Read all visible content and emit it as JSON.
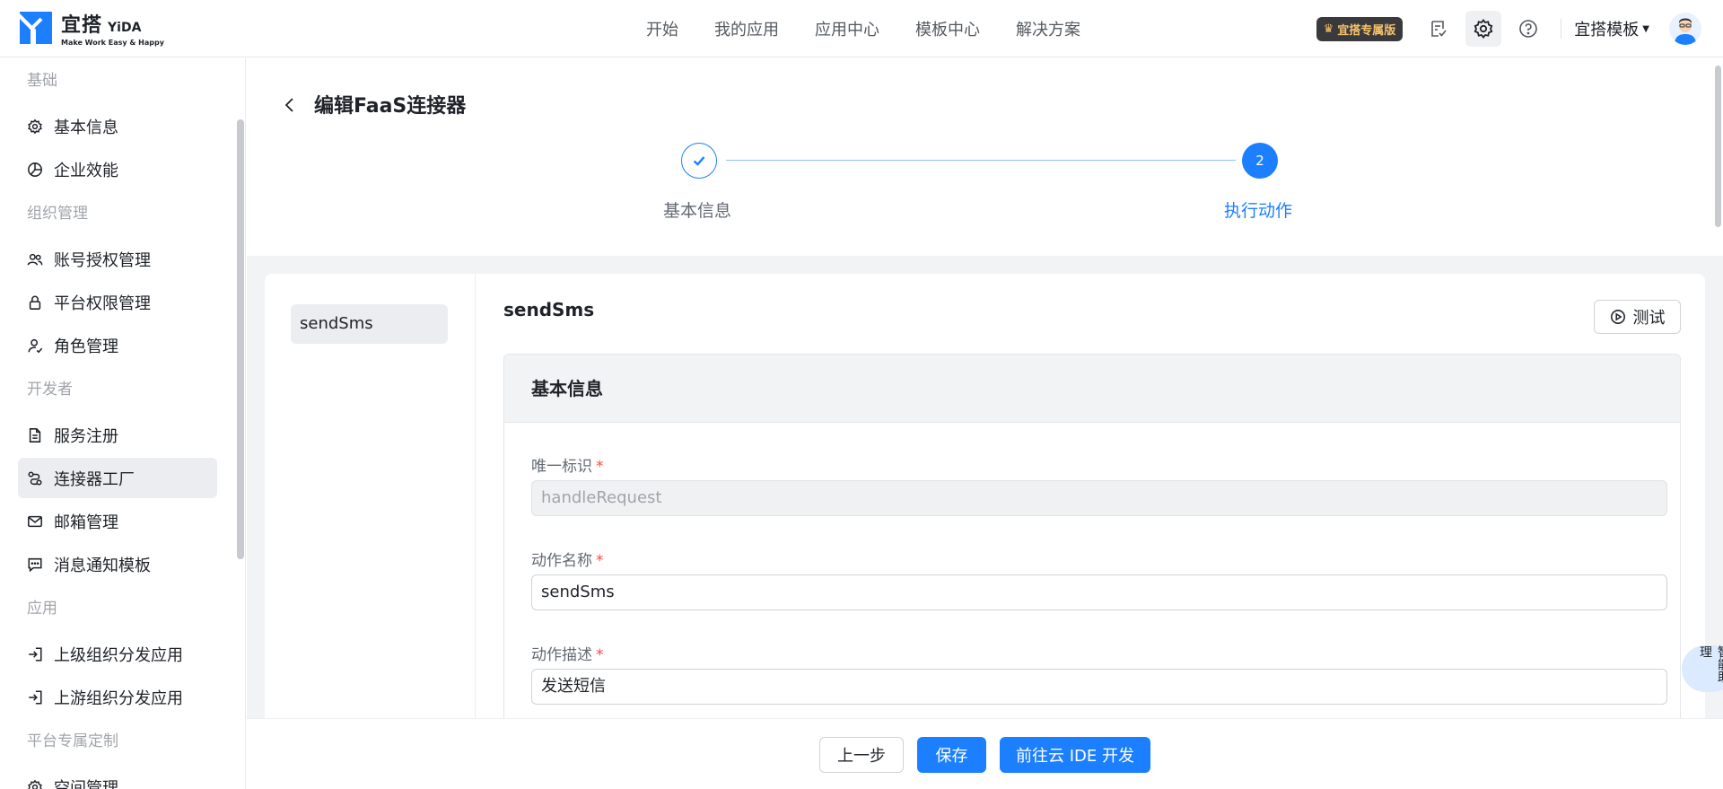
{
  "logo": {
    "cn": "宜搭",
    "en": "YiDA",
    "sub": "Make Work Easy & Happy"
  },
  "nav": [
    "开始",
    "我的应用",
    "应用中心",
    "模板中心",
    "解决方案"
  ],
  "topRight": {
    "vip": "宜搭专属版",
    "templateMenu": "宜搭模板"
  },
  "sidebar": {
    "groups": [
      {
        "title": "基础",
        "items": [
          {
            "label": "基本信息",
            "icon": "gear-icon"
          },
          {
            "label": "企业效能",
            "icon": "pie-chart-icon"
          }
        ]
      },
      {
        "title": "组织管理",
        "items": [
          {
            "label": "账号授权管理",
            "icon": "users-icon"
          },
          {
            "label": "平台权限管理",
            "icon": "lock-icon"
          },
          {
            "label": "角色管理",
            "icon": "user-role-icon"
          }
        ]
      },
      {
        "title": "开发者",
        "items": [
          {
            "label": "服务注册",
            "icon": "document-icon"
          },
          {
            "label": "连接器工厂",
            "icon": "connector-icon",
            "active": true
          },
          {
            "label": "邮箱管理",
            "icon": "mail-icon"
          },
          {
            "label": "消息通知模板",
            "icon": "message-icon"
          }
        ]
      },
      {
        "title": "应用",
        "items": [
          {
            "label": "上级组织分发应用",
            "icon": "import-icon"
          },
          {
            "label": "上游组织分发应用",
            "icon": "import-icon"
          }
        ]
      },
      {
        "title": "平台专属定制",
        "items": [
          {
            "label": "空间管理",
            "icon": "gear-icon"
          }
        ]
      }
    ]
  },
  "page": {
    "title": "编辑FaaS连接器",
    "steps": [
      {
        "label": "基本信息",
        "status": "done"
      },
      {
        "label": "执行动作",
        "number": "2",
        "status": "active"
      }
    ]
  },
  "actions": {
    "list": [
      "sendSms"
    ],
    "current": "sendSms",
    "testLabel": "测试"
  },
  "form": {
    "sectionTitle": "基本信息",
    "fields": [
      {
        "label": "唯一标识",
        "required": "*",
        "value": "handleRequest",
        "disabled": true
      },
      {
        "label": "动作名称",
        "required": "*",
        "value": "sendSms"
      },
      {
        "label": "动作描述",
        "required": "*",
        "value": "发送短信"
      }
    ]
  },
  "footer": {
    "prev": "上一步",
    "save": "保存",
    "ide": "前往云 IDE 开发"
  },
  "floatHelp": "智能助理",
  "colors": {
    "primary": "#1b7fff",
    "vipText": "#f5c26b",
    "online": "#22c55e"
  }
}
